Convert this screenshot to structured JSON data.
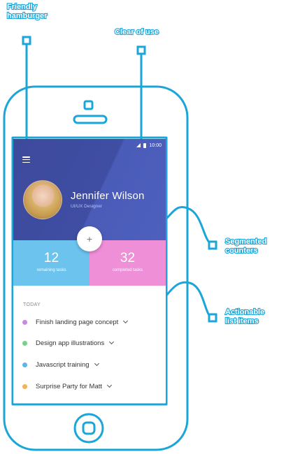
{
  "annotations": {
    "hamburger_label": "Friendly\nhamburger",
    "clock_label": "Clear of use",
    "stats_label": "Segmented\ncounters",
    "list_label": "Actionable\nlist items"
  },
  "statusbar": {
    "time": "10:00"
  },
  "profile": {
    "name": "Jennifer Wilson",
    "role": "UI/UX Designer"
  },
  "stats": {
    "remaining": {
      "count": "12",
      "label": "remaining tasks"
    },
    "completed": {
      "count": "32",
      "label": "completed tasks"
    }
  },
  "fab": {
    "label": "+"
  },
  "section": {
    "title": "TODAY"
  },
  "tasks": [
    {
      "text": "Finish landing page concept",
      "color": "#c58be0"
    },
    {
      "text": "Design app illustrations",
      "color": "#7bcf8c"
    },
    {
      "text": "Javascript training",
      "color": "#5bb6ef"
    },
    {
      "text": "Surprise Party for Matt",
      "color": "#f2b35e"
    }
  ],
  "colors": {
    "outline": "#1ba6d9",
    "header": "#3f4da3",
    "remaining": "#6cc4ee",
    "completed": "#ef8fd8"
  }
}
